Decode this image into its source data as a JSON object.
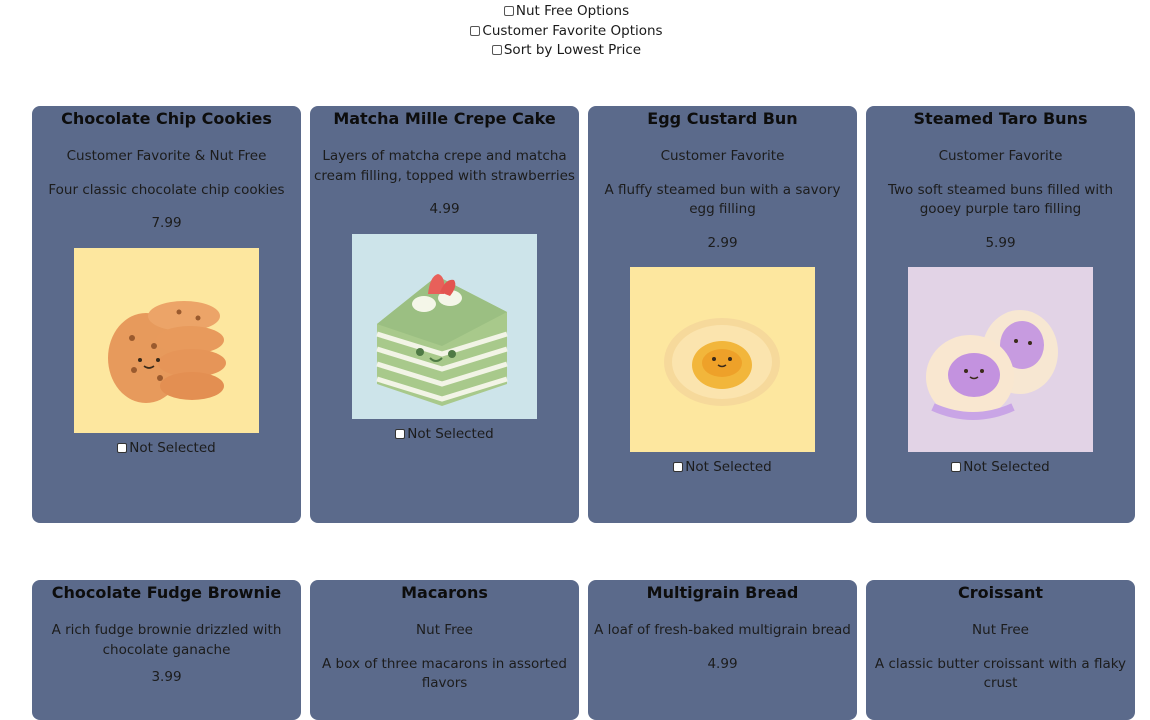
{
  "filters": [
    {
      "label": "Nut Free Options",
      "checked": false
    },
    {
      "label": "Customer Favorite Options",
      "checked": false
    },
    {
      "label": "Sort by Lowest Price",
      "checked": false
    }
  ],
  "selection_label": "Not Selected",
  "items": [
    {
      "name": "Chocolate Chip Cookies",
      "tag": "Customer Favorite & Nut Free",
      "description": "Four classic chocolate chip cookies",
      "price": "7.99",
      "image": "cookies-illustration",
      "image_bg": "#fde79f"
    },
    {
      "name": "Matcha Mille Crepe Cake",
      "tag": "",
      "description": "Layers of matcha crepe and matcha cream filling, topped with strawberries",
      "price": "4.99",
      "image": "matcha-cake-illustration",
      "image_bg": "#cde4ea"
    },
    {
      "name": "Egg Custard Bun",
      "tag": "Customer Favorite",
      "description": "A fluffy steamed bun with a savory egg filling",
      "price": "2.99",
      "image": "custard-bun-illustration",
      "image_bg": "#fde79f"
    },
    {
      "name": "Steamed Taro Buns",
      "tag": "Customer Favorite",
      "description": "Two soft steamed buns filled with gooey purple taro filling",
      "price": "5.99",
      "image": "taro-buns-illustration",
      "image_bg": "#e2d3e6"
    },
    {
      "name": "Chocolate Fudge Brownie",
      "tag": "",
      "description": "A rich fudge brownie drizzled with chocolate ganache",
      "price": "3.99"
    },
    {
      "name": "Macarons",
      "tag": "Nut Free",
      "description": "A box of three macarons in assorted flavors",
      "price": ""
    },
    {
      "name": "Multigrain Bread",
      "tag": "",
      "description": "A loaf of fresh-baked multigrain bread",
      "price": "4.99"
    },
    {
      "name": "Croissant",
      "tag": "Nut Free",
      "description": "A classic butter croissant with a flaky crust",
      "price": ""
    }
  ]
}
